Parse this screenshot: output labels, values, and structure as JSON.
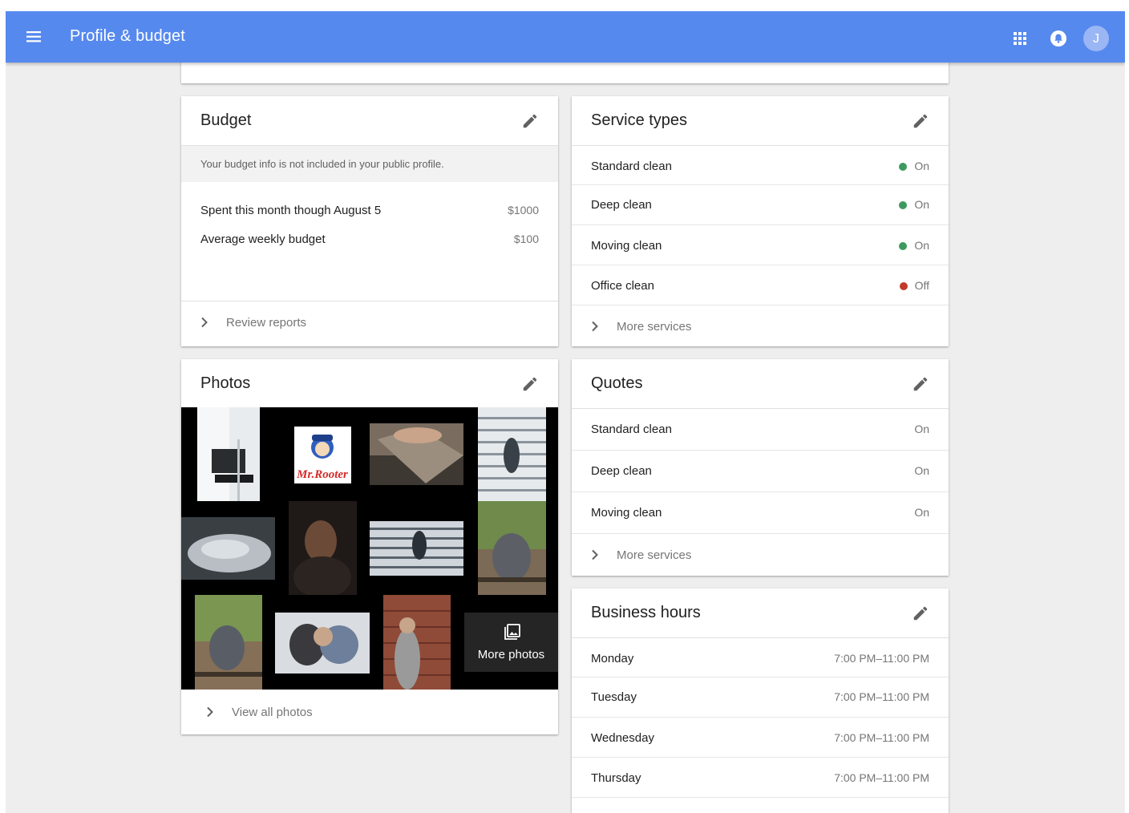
{
  "app": {
    "title": "Profile & budget",
    "avatar_initial": "J",
    "icons": [
      "menu-icon",
      "apps-icon",
      "notifications-icon"
    ],
    "accent_color": "#5689ee"
  },
  "budget": {
    "title": "Budget",
    "note": "Your budget info is not included in your public profile.",
    "rows": [
      {
        "label": "Spent this month though August 5",
        "value": "$1000"
      },
      {
        "label": "Average weekly budget",
        "value": "$100"
      }
    ],
    "link": "Review reports"
  },
  "service_types": {
    "title": "Service types",
    "rows": [
      {
        "label": "Standard clean",
        "status": "On",
        "color": "#3d9a5f"
      },
      {
        "label": "Deep clean",
        "status": "On",
        "color": "#3d9a5f"
      },
      {
        "label": "Moving clean",
        "status": "On",
        "color": "#3d9a5f"
      },
      {
        "label": "Office clean",
        "status": "Off",
        "color": "#c0392b"
      }
    ],
    "link": "More services"
  },
  "photos": {
    "title": "Photos",
    "more_label": "More photos",
    "link": "View all photos",
    "logo_text": "Mr.Rooter"
  },
  "quotes": {
    "title": "Quotes",
    "rows": [
      {
        "label": "Standard clean",
        "status": "On"
      },
      {
        "label": "Deep clean",
        "status": "On"
      },
      {
        "label": "Moving clean",
        "status": "On"
      }
    ],
    "link": "More services"
  },
  "hours": {
    "title": "Business hours",
    "rows": [
      {
        "day": "Monday",
        "time": "7:00 PM–11:00 PM"
      },
      {
        "day": "Tuesday",
        "time": "7:00 PM–11:00 PM"
      },
      {
        "day": "Wednesday",
        "time": "7:00 PM–11:00 PM"
      },
      {
        "day": "Thursday",
        "time": "7:00 PM–11:00 PM"
      }
    ]
  }
}
